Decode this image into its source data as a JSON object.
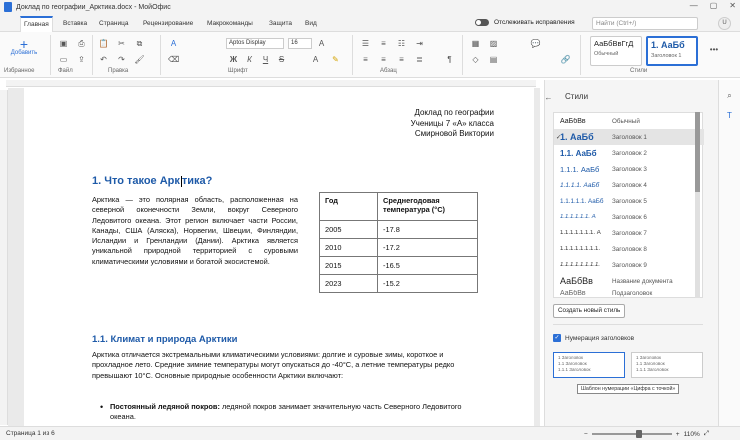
{
  "window": {
    "title": "Доклад по географии_Арктика.docx - МойОфис",
    "controls": [
      "—",
      "▢",
      "✕"
    ]
  },
  "tabs": [
    "Главная",
    "Вставка",
    "Страница",
    "Рецензирование",
    "Макрокоманды",
    "Защита",
    "Вид"
  ],
  "track_changes_label": "Отслеживать исправления",
  "search_placeholder": "Найти (Ctrl+/)",
  "avatar_initial": "U",
  "ribbon": {
    "add_label": "Добавить",
    "groups": [
      "Избранное",
      "Файл",
      "Правка",
      "Шрифт",
      "Абзац",
      "Стили"
    ],
    "font_name": "Aptos Display",
    "font_size": "16",
    "style_cards": [
      {
        "sample": "АаБбВвГгД",
        "name": "Обычный"
      },
      {
        "sample": "1. АаБб",
        "name": "Заголовок 1"
      }
    ],
    "more": "•••"
  },
  "document": {
    "header_lines": [
      "Доклад по географии",
      "Ученицы 7 «А» класса",
      "Смирновой Виктории"
    ],
    "h1_before_cursor": "1.  Что такое Арк",
    "h1_after_cursor": "тика?",
    "para1": "Арктика — это полярная область, расположенная на северной оконечности Земли, вокруг Северного Ледовитого океана. Этот регион включает части России, Канады, США (Аляска), Норвегии, Швеции, Финляндии, Исландии и Гренландии (Дании). Арктика является уникальной природной территорией с суровыми климатическими условиями и богатой экосистемой.",
    "table": {
      "headers": [
        "Год",
        "Среднегодовая температура (°C)"
      ],
      "rows": [
        [
          "2005",
          "-17.8"
        ],
        [
          "2010",
          "-17.2"
        ],
        [
          "2015",
          "-16.5"
        ],
        [
          "2023",
          "-15.2"
        ]
      ]
    },
    "h2": "1.1. Климат и природа Арктики",
    "para2": "Арктика отличается экстремальными климатическими условиями: долгие и суровые зимы, короткое и прохладное лето. Средние зимние температуры могут опускаться до -40°C, а летние температуры редко превышают 10°C. Основные природные особенности Арктики включают:",
    "bullet_bold": "Постоянный ледяной покров:",
    "bullet_text": " ледяной покров занимает значительную часть Северного Ледовитого океана."
  },
  "styles_panel": {
    "title": "Стили",
    "items": [
      {
        "sample": "АаБбВв",
        "name": "Обычный"
      },
      {
        "sample": "1. АаБб",
        "name": "Заголовок 1"
      },
      {
        "sample": "1.1. АаБб",
        "name": "Заголовок 2"
      },
      {
        "sample": "1.1.1. АаБб",
        "name": "Заголовок 3"
      },
      {
        "sample": "1.1.1.1. АаБб",
        "name": "Заголовок 4"
      },
      {
        "sample": "1.1.1.1.1. АаБб",
        "name": "Заголовок 5"
      },
      {
        "sample": "1.1.1.1.1.1. А",
        "name": "Заголовок 6"
      },
      {
        "sample": "1.1.1.1.1.1.1. А",
        "name": "Заголовок 7"
      },
      {
        "sample": "1.1.1.1.1.1.1.1.",
        "name": "Заголовок 8"
      },
      {
        "sample": "1.1.1.1.1.1.1.1.",
        "name": "Заголовок 9"
      },
      {
        "sample": "АаБбВв",
        "name": "Название документа"
      },
      {
        "sample": "АаБбВв",
        "name": "Подзаголовок"
      }
    ],
    "new_style_label": "Создать новый стиль",
    "numbering_label": "Нумерация заголовков",
    "numbering_cards": [
      [
        "1 Заголовок",
        "1.1 Заголовок",
        "1.1.1 Заголовок"
      ],
      [
        "1 Заголовок",
        "1.1 Заголовок",
        "1.1.1 Заголовок"
      ]
    ],
    "tooltip": "Шаблон нумерации «Цифра с точкой»"
  },
  "status": {
    "page": "Страница 1 из 6",
    "zoom": "110%"
  },
  "colors": {
    "accent": "#2b6fd6",
    "heading": "#1e5aa8"
  }
}
